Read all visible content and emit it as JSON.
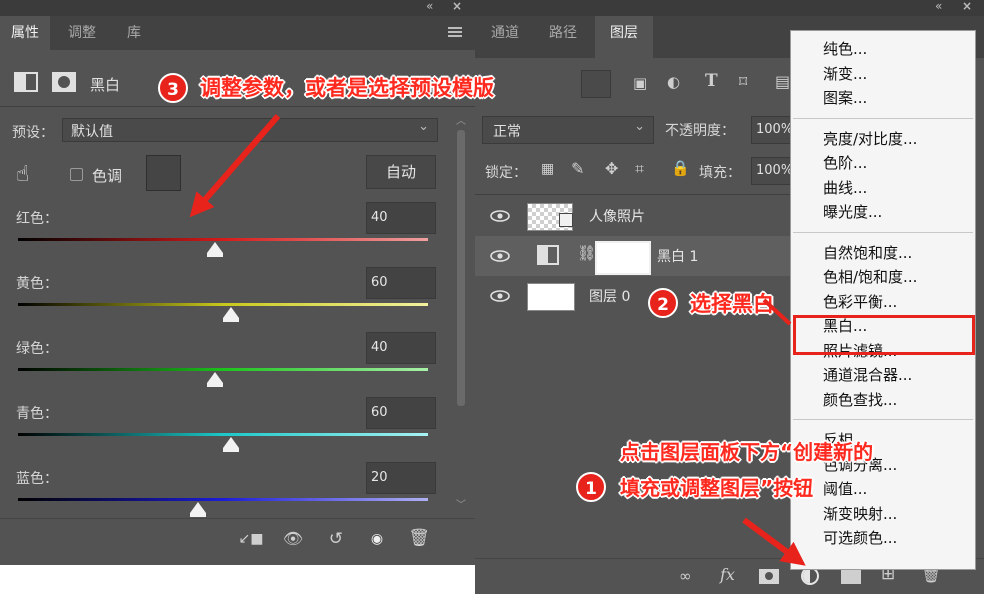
{
  "left_panel": {
    "tabs": [
      "属性",
      "调整",
      "库"
    ],
    "active_tab": "属性",
    "header_title": "黑白",
    "preset_label": "预设：",
    "preset_value": "默认值",
    "tint_label": "色调",
    "auto_button": "自动",
    "sliders": [
      {
        "label": "红色：",
        "value": "40",
        "level": 0.48,
        "gradient": [
          "#000000",
          "#d61a1a",
          "#f0a0a0"
        ]
      },
      {
        "label": "黄色：",
        "value": "60",
        "level": 0.52,
        "gradient": [
          "#000000",
          "#c8c81c",
          "#f2f2a0"
        ]
      },
      {
        "label": "绿色：",
        "value": "40",
        "level": 0.48,
        "gradient": [
          "#000000",
          "#1cc21c",
          "#a8f0a8"
        ]
      },
      {
        "label": "青色：",
        "value": "60",
        "level": 0.52,
        "gradient": [
          "#000000",
          "#1cc8c8",
          "#a8f2f2"
        ]
      },
      {
        "label": "蓝色：",
        "value": "20",
        "level": 0.44,
        "gradient": [
          "#000000",
          "#1c1cd8",
          "#b0b0f4"
        ]
      }
    ]
  },
  "right_panel": {
    "tabs": [
      "通道",
      "路径",
      "图层"
    ],
    "active_tab": "图层",
    "blend_mode": "正常",
    "opacity_label": "不透明度：",
    "opacity_value": "100%",
    "lock_label": "锁定：",
    "fill_label": "填充：",
    "fill_value": "100%",
    "layers": [
      {
        "name": "人像照片"
      },
      {
        "name": "黑白 1"
      },
      {
        "name": "图层 0"
      }
    ]
  },
  "menu": {
    "group1": [
      "纯色...",
      "渐变...",
      "图案..."
    ],
    "group2": [
      "亮度/对比度...",
      "色阶...",
      "曲线...",
      "曝光度..."
    ],
    "group3": [
      "自然饱和度...",
      "色相/饱和度...",
      "色彩平衡...",
      "黑白...",
      "照片滤镜...",
      "通道混合器...",
      "颜色查找..."
    ],
    "group4": [
      "反相",
      "色调分离...",
      "阈值...",
      "渐变映射...",
      "可选颜色..."
    ]
  },
  "annotations": {
    "step1_num": "1",
    "step1_line1": "点击图层面板下方“创建新的",
    "step1_line2": "填充或调整图层”按钮",
    "step2_num": "2",
    "step2_text": "选择黑白",
    "step3_num": "3",
    "step3_text": "调整参数，或者是选择预设模版"
  },
  "colors": {
    "annotation_red": "#ff2a1f",
    "panel_bg": "#535353",
    "menu_bg": "#f5f5f5"
  }
}
